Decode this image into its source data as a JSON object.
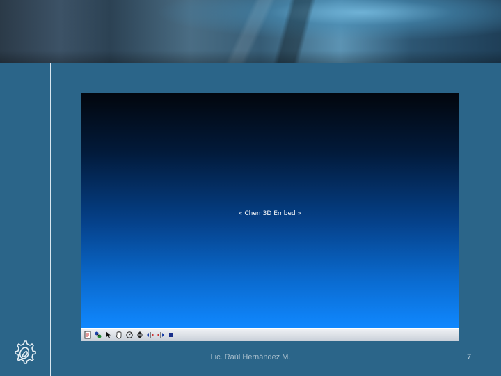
{
  "embed": {
    "label": "« Chem3D Embed »"
  },
  "toolbar": {
    "icons": [
      "page-icon",
      "model-icon",
      "arrow-icon",
      "hand-icon",
      "rotate-icon",
      "zoom-icon",
      "move-left-icon",
      "move-right-icon",
      "stop-icon"
    ]
  },
  "footer": {
    "author": "Lic. Raúl Hernández M.",
    "page_number": "7"
  },
  "colors": {
    "background": "#2b6589",
    "embed_top": "#02060d",
    "embed_bottom": "#1088ff",
    "rule": "#d8e6ef"
  }
}
